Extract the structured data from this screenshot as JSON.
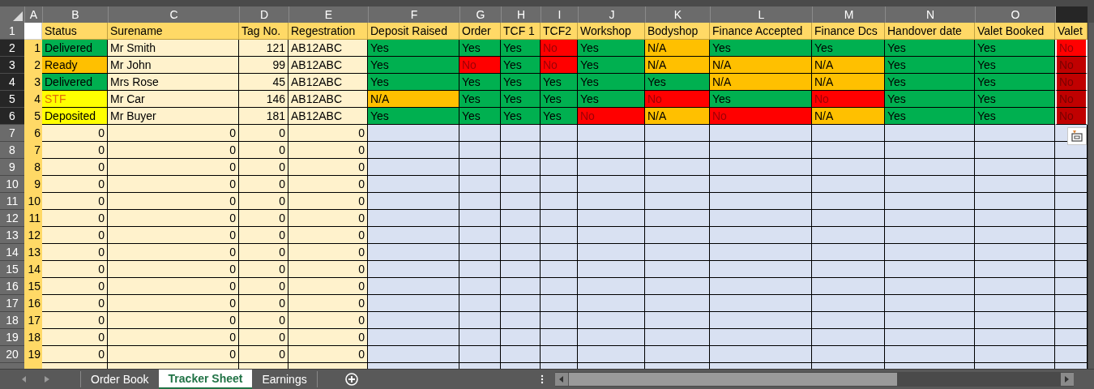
{
  "columns": [
    {
      "letter": "A",
      "selected": false
    },
    {
      "letter": "B",
      "selected": false
    },
    {
      "letter": "C",
      "selected": false
    },
    {
      "letter": "D",
      "selected": false
    },
    {
      "letter": "E",
      "selected": false
    },
    {
      "letter": "F",
      "selected": false
    },
    {
      "letter": "G",
      "selected": false
    },
    {
      "letter": "H",
      "selected": false
    },
    {
      "letter": "I",
      "selected": false
    },
    {
      "letter": "J",
      "selected": false
    },
    {
      "letter": "K",
      "selected": false
    },
    {
      "letter": "L",
      "selected": false
    },
    {
      "letter": "M",
      "selected": false
    },
    {
      "letter": "N",
      "selected": false
    },
    {
      "letter": "O",
      "selected": false
    },
    {
      "selected": true
    }
  ],
  "header_row": {
    "number": "1",
    "selected": false,
    "cells": [
      "Status",
      "Surename",
      "Tag No.",
      "Regestration",
      "Deposit Raised",
      "Order",
      "TCF 1",
      "TCF2",
      "Workshop",
      "Bodyshop",
      "Finance Accepted",
      "Finance Dcs",
      "Handover date",
      "Valet Booked",
      "Valet"
    ]
  },
  "rows": [
    {
      "number": "2",
      "index": "1",
      "selected": true,
      "cells": [
        {
          "text": "Delivered",
          "color": "#00b050"
        },
        {
          "text": "Mr Smith"
        },
        {
          "text": "121",
          "kind": "number"
        },
        {
          "text": "AB12ABC"
        },
        {
          "text": "Yes",
          "color": "#00b050"
        },
        {
          "text": "Yes",
          "color": "#00b050"
        },
        {
          "text": "Yes",
          "color": "#00b050"
        },
        {
          "text": "No",
          "color": "#ff0000"
        },
        {
          "text": "Yes",
          "color": "#00b050"
        },
        {
          "text": "N/A",
          "color": "#ffc000"
        },
        {
          "text": "Yes",
          "color": "#00b050"
        },
        {
          "text": "Yes",
          "color": "#00b050"
        },
        {
          "text": "Yes",
          "color": "#00b050"
        },
        {
          "text": "Yes",
          "color": "#00b050"
        },
        {
          "text": "No",
          "color": "#ff0000"
        }
      ]
    },
    {
      "number": "3",
      "index": "2",
      "selected": true,
      "cells": [
        {
          "text": "Ready",
          "color": "#ffc000"
        },
        {
          "text": "Mr John"
        },
        {
          "text": "99",
          "kind": "number"
        },
        {
          "text": "AB12ABC"
        },
        {
          "text": "Yes",
          "color": "#00b050"
        },
        {
          "text": "No",
          "color": "#ff0000"
        },
        {
          "text": "Yes",
          "color": "#00b050"
        },
        {
          "text": "No",
          "color": "#ff0000"
        },
        {
          "text": "Yes",
          "color": "#00b050"
        },
        {
          "text": "N/A",
          "color": "#ffc000"
        },
        {
          "text": "N/A",
          "color": "#ffc000"
        },
        {
          "text": "N/A",
          "color": "#ffc000"
        },
        {
          "text": "Yes",
          "color": "#00b050"
        },
        {
          "text": "Yes",
          "color": "#00b050"
        },
        {
          "text": "No",
          "color": "#c00000"
        }
      ]
    },
    {
      "number": "4",
      "index": "3",
      "selected": true,
      "cells": [
        {
          "text": "Delivered",
          "color": "#00b050"
        },
        {
          "text": "Mrs Rose"
        },
        {
          "text": "45",
          "kind": "number"
        },
        {
          "text": "AB12ABC"
        },
        {
          "text": "Yes",
          "color": "#00b050"
        },
        {
          "text": "Yes",
          "color": "#00b050"
        },
        {
          "text": "Yes",
          "color": "#00b050"
        },
        {
          "text": "Yes",
          "color": "#00b050"
        },
        {
          "text": "Yes",
          "color": "#00b050"
        },
        {
          "text": "Yes",
          "color": "#00b050"
        },
        {
          "text": "N/A",
          "color": "#ffc000"
        },
        {
          "text": "N/A",
          "color": "#ffc000"
        },
        {
          "text": "Yes",
          "color": "#00b050"
        },
        {
          "text": "Yes",
          "color": "#00b050"
        },
        {
          "text": "No",
          "color": "#c00000"
        }
      ]
    },
    {
      "number": "5",
      "index": "4",
      "selected": true,
      "cells": [
        {
          "text": "STF",
          "color": "#ffff00",
          "kind": "alert"
        },
        {
          "text": "Mr Car"
        },
        {
          "text": "146",
          "kind": "number"
        },
        {
          "text": "AB12ABC"
        },
        {
          "text": "N/A",
          "color": "#ffc000"
        },
        {
          "text": "Yes",
          "color": "#00b050"
        },
        {
          "text": "Yes",
          "color": "#00b050"
        },
        {
          "text": "Yes",
          "color": "#00b050"
        },
        {
          "text": "Yes",
          "color": "#00b050"
        },
        {
          "text": "No",
          "color": "#ff0000"
        },
        {
          "text": "Yes",
          "color": "#00b050"
        },
        {
          "text": "No",
          "color": "#ff0000"
        },
        {
          "text": "Yes",
          "color": "#00b050"
        },
        {
          "text": "Yes",
          "color": "#00b050"
        },
        {
          "text": "No",
          "color": "#c00000"
        }
      ]
    },
    {
      "number": "6",
      "index": "5",
      "selected": true,
      "cells": [
        {
          "text": "Deposited",
          "color": "#ffff00"
        },
        {
          "text": "Mr Buyer"
        },
        {
          "text": "181",
          "kind": "number"
        },
        {
          "text": "AB12ABC"
        },
        {
          "text": "Yes",
          "color": "#00b050"
        },
        {
          "text": "Yes",
          "color": "#00b050"
        },
        {
          "text": "Yes",
          "color": "#00b050"
        },
        {
          "text": "Yes",
          "color": "#00b050"
        },
        {
          "text": "No",
          "color": "#ff0000"
        },
        {
          "text": "N/A",
          "color": "#ffc000"
        },
        {
          "text": "No",
          "color": "#ff0000"
        },
        {
          "text": "N/A",
          "color": "#ffc000"
        },
        {
          "text": "Yes",
          "color": "#00b050"
        },
        {
          "text": "Yes",
          "color": "#00b050"
        },
        {
          "text": "No",
          "color": "#c00000"
        }
      ]
    },
    {
      "number": "7",
      "index": "6",
      "selected": false,
      "cells": [
        {
          "text": "0",
          "kind": "number"
        },
        {
          "text": "0",
          "kind": "number"
        },
        {
          "text": "0",
          "kind": "number"
        },
        {
          "text": "0",
          "kind": "number"
        }
      ]
    },
    {
      "number": "8",
      "index": "7",
      "selected": false,
      "cells": [
        {
          "text": "0",
          "kind": "number"
        },
        {
          "text": "0",
          "kind": "number"
        },
        {
          "text": "0",
          "kind": "number"
        },
        {
          "text": "0",
          "kind": "number"
        }
      ]
    },
    {
      "number": "9",
      "index": "8",
      "selected": false,
      "cells": [
        {
          "text": "0",
          "kind": "number"
        },
        {
          "text": "0",
          "kind": "number"
        },
        {
          "text": "0",
          "kind": "number"
        },
        {
          "text": "0",
          "kind": "number"
        }
      ]
    },
    {
      "number": "10",
      "index": "9",
      "selected": false,
      "cells": [
        {
          "text": "0",
          "kind": "number"
        },
        {
          "text": "0",
          "kind": "number"
        },
        {
          "text": "0",
          "kind": "number"
        },
        {
          "text": "0",
          "kind": "number"
        }
      ]
    },
    {
      "number": "11",
      "index": "10",
      "selected": false,
      "cells": [
        {
          "text": "0",
          "kind": "number"
        },
        {
          "text": "0",
          "kind": "number"
        },
        {
          "text": "0",
          "kind": "number"
        },
        {
          "text": "0",
          "kind": "number"
        }
      ]
    },
    {
      "number": "12",
      "index": "11",
      "selected": false,
      "cells": [
        {
          "text": "0",
          "kind": "number"
        },
        {
          "text": "0",
          "kind": "number"
        },
        {
          "text": "0",
          "kind": "number"
        },
        {
          "text": "0",
          "kind": "number"
        }
      ]
    },
    {
      "number": "13",
      "index": "12",
      "selected": false,
      "cells": [
        {
          "text": "0",
          "kind": "number"
        },
        {
          "text": "0",
          "kind": "number"
        },
        {
          "text": "0",
          "kind": "number"
        },
        {
          "text": "0",
          "kind": "number"
        }
      ]
    },
    {
      "number": "14",
      "index": "13",
      "selected": false,
      "cells": [
        {
          "text": "0",
          "kind": "number"
        },
        {
          "text": "0",
          "kind": "number"
        },
        {
          "text": "0",
          "kind": "number"
        },
        {
          "text": "0",
          "kind": "number"
        }
      ]
    },
    {
      "number": "15",
      "index": "14",
      "selected": false,
      "cells": [
        {
          "text": "0",
          "kind": "number"
        },
        {
          "text": "0",
          "kind": "number"
        },
        {
          "text": "0",
          "kind": "number"
        },
        {
          "text": "0",
          "kind": "number"
        }
      ]
    },
    {
      "number": "16",
      "index": "15",
      "selected": false,
      "cells": [
        {
          "text": "0",
          "kind": "number"
        },
        {
          "text": "0",
          "kind": "number"
        },
        {
          "text": "0",
          "kind": "number"
        },
        {
          "text": "0",
          "kind": "number"
        }
      ]
    },
    {
      "number": "17",
      "index": "16",
      "selected": false,
      "cells": [
        {
          "text": "0",
          "kind": "number"
        },
        {
          "text": "0",
          "kind": "number"
        },
        {
          "text": "0",
          "kind": "number"
        },
        {
          "text": "0",
          "kind": "number"
        }
      ]
    },
    {
      "number": "18",
      "index": "17",
      "selected": false,
      "cells": [
        {
          "text": "0",
          "kind": "number"
        },
        {
          "text": "0",
          "kind": "number"
        },
        {
          "text": "0",
          "kind": "number"
        },
        {
          "text": "0",
          "kind": "number"
        }
      ]
    },
    {
      "number": "19",
      "index": "18",
      "selected": false,
      "cells": [
        {
          "text": "0",
          "kind": "number"
        },
        {
          "text": "0",
          "kind": "number"
        },
        {
          "text": "0",
          "kind": "number"
        },
        {
          "text": "0",
          "kind": "number"
        }
      ]
    },
    {
      "number": "20",
      "index": "19",
      "selected": false,
      "cells": [
        {
          "text": "0",
          "kind": "number"
        },
        {
          "text": "0",
          "kind": "number"
        },
        {
          "text": "0",
          "kind": "number"
        },
        {
          "text": "0",
          "kind": "number"
        }
      ]
    }
  ],
  "sheet_tabs": [
    {
      "label": "Order Book",
      "selected": false
    },
    {
      "label": "Tracker Sheet",
      "selected": true
    },
    {
      "label": "Earnings",
      "selected": false
    }
  ]
}
